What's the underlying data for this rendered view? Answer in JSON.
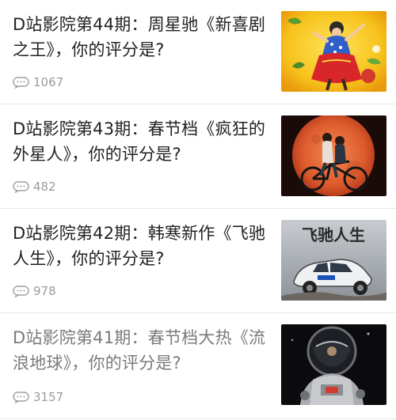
{
  "articles": [
    {
      "title": "D站影院第44期：周星驰《新喜剧之王》，你的评分是?",
      "comment_count": "1067",
      "thumbnail_icon": "movie-poster-new-king-of-comedy",
      "read": false
    },
    {
      "title": "D站影院第43期：春节档《疯狂的外星人》，你的评分是?",
      "comment_count": "482",
      "thumbnail_icon": "movie-poster-crazy-alien",
      "read": false
    },
    {
      "title": "D站影院第42期：韩寒新作《飞驰人生》，你的评分是?",
      "comment_count": "978",
      "thumbnail_icon": "movie-poster-pegasus",
      "thumbnail_text": "飞驰人生",
      "read": false
    },
    {
      "title": "D站影院第41期：春节档大热《流浪地球》，你的评分是?",
      "comment_count": "3157",
      "thumbnail_icon": "movie-poster-wandering-earth",
      "read": true
    }
  ]
}
